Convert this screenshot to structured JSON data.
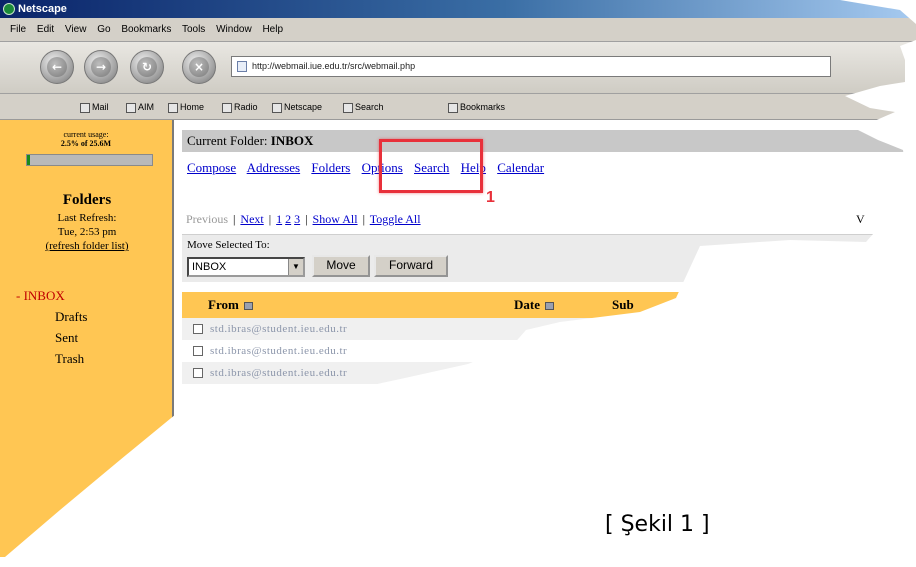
{
  "window": {
    "title": "Netscape"
  },
  "menubar": {
    "items": [
      "File",
      "Edit",
      "View",
      "Go",
      "Bookmarks",
      "Tools",
      "Window",
      "Help"
    ]
  },
  "address_bar": {
    "url": "http://webmail.iue.edu.tr/src/webmail.php"
  },
  "personal_toolbar": {
    "items": [
      "Mail",
      "AIM",
      "Home",
      "Radio",
      "Netscape",
      "Search",
      "Bookmarks"
    ]
  },
  "left_pane": {
    "usage_label": "current usage:",
    "usage_value": "2.5% of 25.6M",
    "usage_fraction": 0.025,
    "folders_title": "Folders",
    "last_refresh_label": "Last Refresh:",
    "last_refresh_time": "Tue, 2:53 pm",
    "refresh_link": "(refresh folder list)",
    "folders": [
      "- INBOX",
      "Drafts",
      "Sent",
      "Trash"
    ]
  },
  "main": {
    "current_folder_label": "Current Folder:",
    "current_folder": "INBOX",
    "menu": [
      "Compose",
      "Addresses",
      "Folders",
      "Options",
      "Search",
      "Help",
      "Calendar"
    ],
    "pager": {
      "previous": "Previous",
      "next": "Next",
      "pages": [
        "1",
        "2",
        "3"
      ],
      "show_all": "Show All",
      "toggle_all": "Toggle All",
      "right_text": "V"
    },
    "move_label": "Move Selected To:",
    "move_select_value": "INBOX",
    "move_button": "Move",
    "forward_button": "Forward",
    "columns": {
      "from": "From",
      "date": "Date",
      "subject": "Sub"
    },
    "rows": [
      "std.ibras@student.ieu.edu.tr",
      "std.ibras@student.ieu.edu.tr",
      "std.ibras@student.ieu.edu.tr"
    ]
  },
  "annotation": {
    "step": "1",
    "caption": "[ Şekil 1 ]",
    "color": "#e8303a"
  },
  "colors": {
    "folder_pane": "#ffc653",
    "link": "#0000cc",
    "current_folder": "#c00000"
  }
}
